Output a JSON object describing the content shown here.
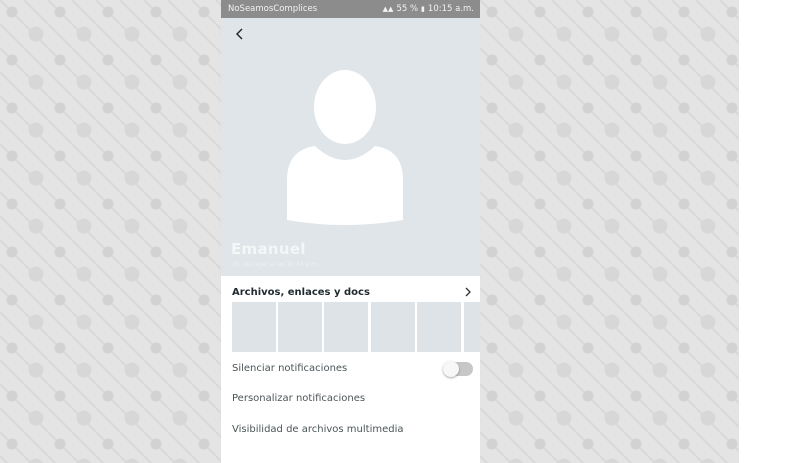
{
  "status_bar": {
    "carrier": "NoSeamosComplices",
    "battery": "55 %",
    "time": "10:15 a.m."
  },
  "contact": {
    "name": "Emanuel",
    "last_seen": "últ. vez ayer a las 10:24 p.m."
  },
  "media": {
    "title": "Archivos, enlaces y docs",
    "thumbnail_count": 6
  },
  "settings": {
    "mute_label": "Silenciar notificaciones",
    "mute_enabled": false,
    "custom_notifications_label": "Personalizar notificaciones",
    "media_visibility_label": "Visibilidad de archivos multimedia"
  },
  "colors": {
    "header_bg": "#dfe5e8",
    "status_bar_bg": "#8c8c8c",
    "thumbnail_bg": "#dde3e6"
  },
  "icons": {
    "back": "arrow-left-icon",
    "chevron": "chevron-right-icon",
    "avatar": "default-avatar-icon"
  }
}
